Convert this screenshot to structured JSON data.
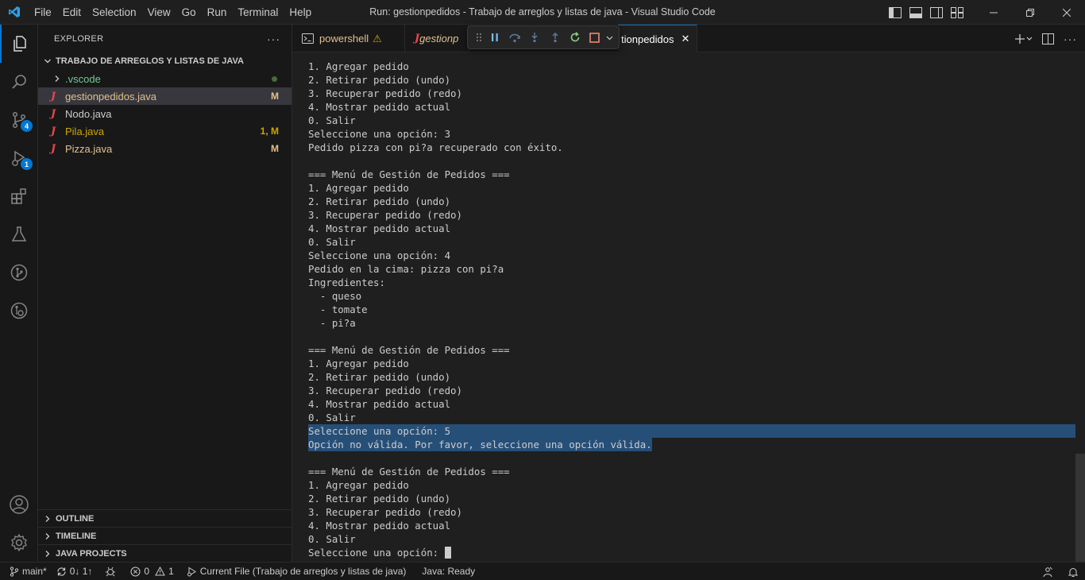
{
  "titlebar": {
    "menu": [
      "File",
      "Edit",
      "Selection",
      "View",
      "Go",
      "Run",
      "Terminal",
      "Help"
    ],
    "title": "Run: gestionpedidos - Trabajo de arreglos y listas de java - Visual Studio Code"
  },
  "activity": {
    "source_control_badge": "4",
    "run_debug_badge": "1"
  },
  "sidebar": {
    "header": "EXPLORER",
    "more": "···",
    "folder": "TRABAJO DE ARREGLOS Y LISTAS DE JAVA",
    "items": [
      {
        "name": ".vscode",
        "status": ""
      },
      {
        "name": "gestionpedidos.java",
        "status": "M"
      },
      {
        "name": "Nodo.java",
        "status": ""
      },
      {
        "name": "Pila.java",
        "status": "1, M"
      },
      {
        "name": "Pizza.java",
        "status": "M"
      }
    ],
    "sections": [
      "OUTLINE",
      "TIMELINE",
      "JAVA PROJECTS"
    ]
  },
  "tabs": [
    {
      "label": "powershell",
      "warning": "⚠"
    },
    {
      "label": "gestionp"
    },
    {
      "label": "tionpedidos",
      "close": "✕"
    }
  ],
  "terminal": {
    "lines": [
      "1. Agregar pedido",
      "2. Retirar pedido (undo)",
      "3. Recuperar pedido (redo)",
      "4. Mostrar pedido actual",
      "0. Salir",
      "Seleccione una opción: 3",
      "Pedido pizza con pi?a recuperado con éxito.",
      "",
      "=== Menú de Gestión de Pedidos ===",
      "1. Agregar pedido",
      "2. Retirar pedido (undo)",
      "3. Recuperar pedido (redo)",
      "4. Mostrar pedido actual",
      "0. Salir",
      "Seleccione una opción: 4",
      "Pedido en la cima: pizza con pi?a",
      "Ingredientes:",
      "  - queso",
      "  - tomate",
      "  - pi?a",
      "",
      "=== Menú de Gestión de Pedidos ===",
      "1. Agregar pedido",
      "2. Retirar pedido (undo)",
      "3. Recuperar pedido (redo)",
      "4. Mostrar pedido actual",
      "0. Salir",
      "Seleccione una opción: 5",
      "Opción no válida. Por favor, seleccione una opción válida.",
      "",
      "=== Menú de Gestión de Pedidos ===",
      "1. Agregar pedido",
      "2. Retirar pedido (undo)",
      "3. Recuperar pedido (redo)",
      "4. Mostrar pedido actual",
      "0. Salir",
      "Seleccione una opción: "
    ],
    "selected_lines": [
      27,
      28
    ]
  },
  "statusbar": {
    "branch": "main*",
    "sync": "0↓ 1↑",
    "errors": "0",
    "warnings": "1",
    "current_file": "Current File (Trabajo de arreglos y listas de java)",
    "java_status": "Java: Ready"
  },
  "colors": {
    "accent": "#0078d4",
    "selection": "#264f78",
    "modified": "#e2c08d",
    "java_icon": "#e8454a"
  }
}
